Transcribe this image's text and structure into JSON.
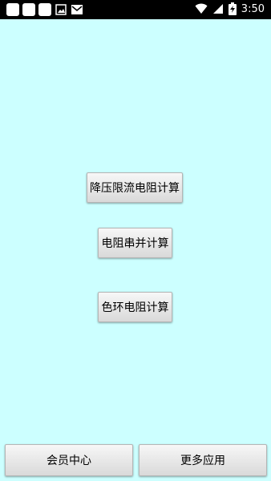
{
  "status_bar": {
    "time": "3:50",
    "icons": [
      "notification-square-icon",
      "notification-square-icon",
      "notification-square-icon",
      "image-icon",
      "mail-icon",
      "wifi-icon",
      "signal-icon",
      "battery-charging-icon"
    ]
  },
  "main": {
    "buttons": [
      {
        "label": "降压限流电阻计算"
      },
      {
        "label": "电阻串并计算"
      },
      {
        "label": "色环电阻计算"
      }
    ]
  },
  "footer": {
    "left_label": "会员中心",
    "right_label": "更多应用"
  },
  "colors": {
    "background": "#ccffff",
    "status_bar": "#000000"
  }
}
